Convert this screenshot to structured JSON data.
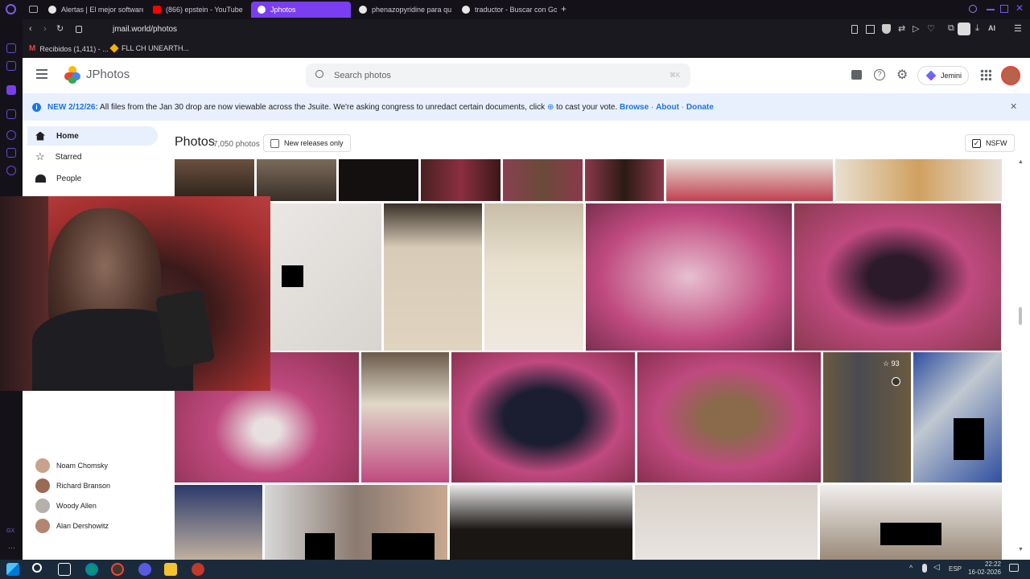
{
  "browser": {
    "tabs": [
      {
        "label": "Alertas | El mejor software",
        "color": "#e8e8e8"
      },
      {
        "label": "(866) epstein - YouTube",
        "color": "#ff0000"
      },
      {
        "label": "Jphotos",
        "color": "#ffffff"
      },
      {
        "label": "phenazopyridine para qu",
        "color": "#e8e8e8"
      },
      {
        "label": "traductor - Buscar con Go",
        "color": "#e8e8e8"
      }
    ],
    "new_tab": "+",
    "url": "jmail.world/photos",
    "bookmarks": [
      {
        "label": "Recibidos (1,411) - ..."
      },
      {
        "label": "FLL CH UNEARTH..."
      }
    ],
    "ai_label": "AI"
  },
  "app": {
    "title": "JPhotos",
    "search_placeholder": "Search photos",
    "search_shortcut": "⌘K",
    "jemini_label": "Jemini",
    "banner": {
      "tag": "NEW 2/12/26:",
      "text": "All files from the Jan 30 drop are now viewable across the Jsuite. We're asking congress to unredact certain documents, click",
      "text2": "to cast your vote.",
      "link_browse": "Browse",
      "sep": "·",
      "link_about": "About",
      "link_donate": "Donate"
    },
    "nav": [
      {
        "label": "Home",
        "icon": "home-icon"
      },
      {
        "label": "Starred",
        "icon": "star-icon"
      },
      {
        "label": "People",
        "icon": "people-icon"
      }
    ],
    "people": [
      {
        "name": "Noam Chomsky"
      },
      {
        "name": "Richard Branson"
      },
      {
        "name": "Woody Allen"
      },
      {
        "name": "Alan Dershowitz"
      }
    ],
    "main": {
      "heading": "Photos",
      "count": "7,050 photos",
      "filter_label": "New releases only",
      "nsfw_label": "NSFW",
      "star_count": "93"
    }
  },
  "taskbar": {
    "lang": "ESP",
    "time": "22:22",
    "date": "16-02-2026"
  }
}
